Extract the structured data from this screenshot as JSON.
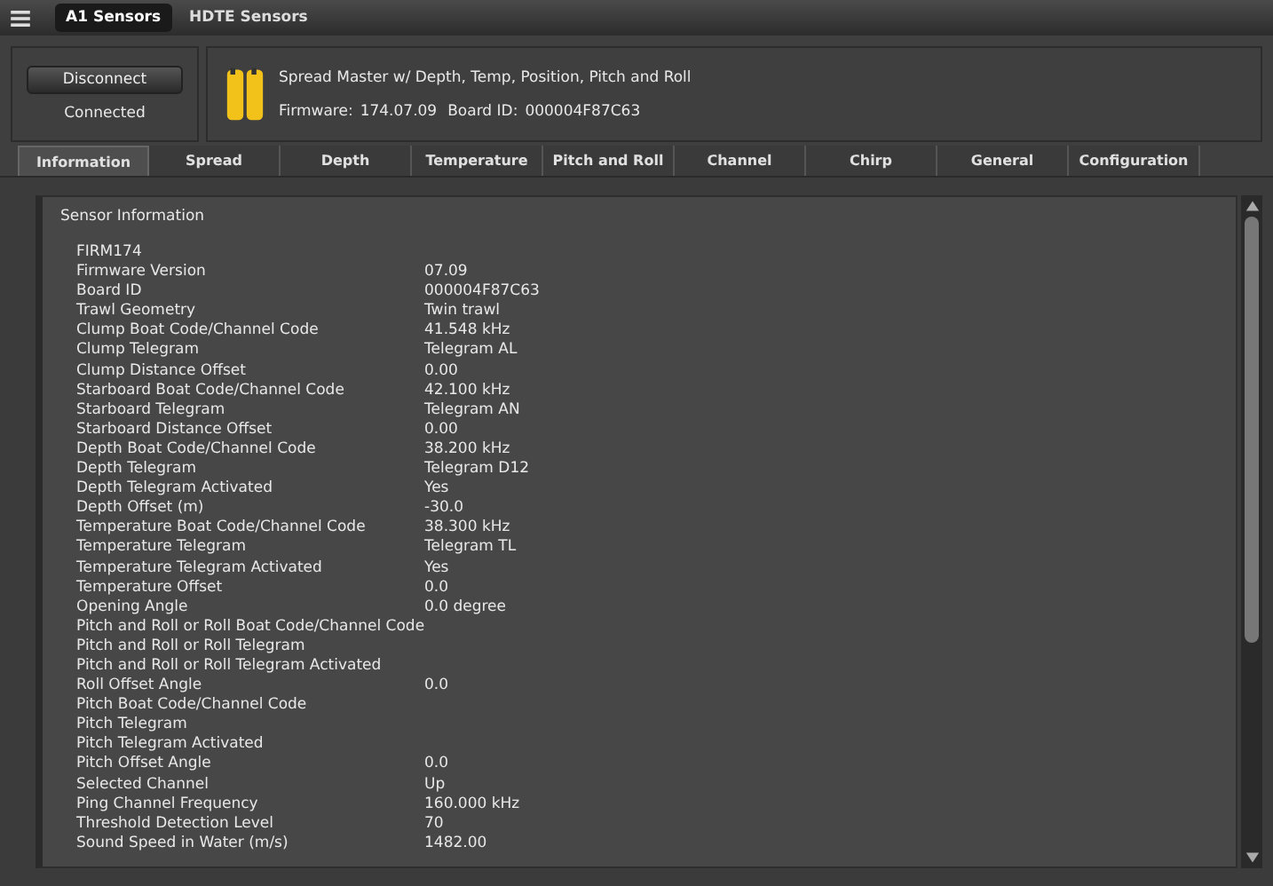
{
  "top_tabs": [
    {
      "label": "A1 Sensors",
      "selected": true
    },
    {
      "label": "HDTE Sensors",
      "selected": false
    }
  ],
  "connection": {
    "button": "Disconnect",
    "status": "Connected"
  },
  "sensor": {
    "name": "Spread Master w/ Depth, Temp, Position, Pitch and Roll",
    "firmware_label": "Firmware:",
    "firmware": "174.07.09",
    "board_label": "Board ID:",
    "board_id": "000004F87C63"
  },
  "tabs": [
    {
      "label": "Information",
      "selected": true
    },
    {
      "label": "Spread",
      "selected": false
    },
    {
      "label": "Depth",
      "selected": false
    },
    {
      "label": "Temperature",
      "selected": false
    },
    {
      "label": "Pitch and Roll",
      "selected": false
    },
    {
      "label": "Channel",
      "selected": false
    },
    {
      "label": "Chirp",
      "selected": false
    },
    {
      "label": "General",
      "selected": false
    },
    {
      "label": "Configuration",
      "selected": false
    }
  ],
  "panel": {
    "title": "Sensor Information",
    "rows": [
      {
        "label": "FIRM174"
      },
      {
        "label": "Firmware Version",
        "value": "07.09"
      },
      {
        "label": "Board ID",
        "value": "000004F87C63"
      },
      {
        "label": "Trawl Geometry",
        "value": "Twin trawl"
      },
      {
        "label": "Clump Boat Code/Channel Code",
        "value": "41.548 kHz"
      },
      {
        "label": "Clump Telegram",
        "value": "Telegram AL"
      },
      {
        "label": "Clump Distance Offset",
        "value": "0.00"
      },
      {
        "label": "Starboard Boat Code/Channel Code",
        "value": "42.100 kHz"
      },
      {
        "label": "Starboard Telegram",
        "value": "Telegram AN"
      },
      {
        "label": "Starboard Distance Offset",
        "value": "0.00"
      },
      {
        "label": "Depth Boat Code/Channel Code",
        "value": "38.200 kHz"
      },
      {
        "label": "Depth Telegram",
        "value": "Telegram D12"
      },
      {
        "label": "Depth Telegram Activated",
        "value": "Yes"
      },
      {
        "label": "Depth Offset (m)",
        "value": "-30.0"
      },
      {
        "label": "Temperature Boat Code/Channel Code",
        "value": "38.300 kHz"
      },
      {
        "label": "Temperature Telegram",
        "value": "Telegram TL"
      },
      {
        "label": "Temperature Telegram Activated",
        "value": "Yes"
      },
      {
        "label": "Temperature Offset",
        "value": "0.0"
      },
      {
        "label": "Opening Angle",
        "value": "0.0 degree"
      },
      {
        "label": "Pitch and Roll or Roll Boat Code/Channel Code"
      },
      {
        "label": "Pitch and Roll or Roll Telegram"
      },
      {
        "label": "Pitch and Roll or Roll Telegram Activated"
      },
      {
        "label": "Roll Offset Angle",
        "value": "0.0"
      },
      {
        "label": "Pitch Boat Code/Channel Code"
      },
      {
        "label": "Pitch Telegram"
      },
      {
        "label": "Pitch Telegram Activated"
      },
      {
        "label": "Pitch Offset Angle",
        "value": "0.0"
      },
      {
        "label": "Selected Channel",
        "value": "Up"
      },
      {
        "label": "Ping Channel Frequency",
        "value": "160.000 kHz"
      },
      {
        "label": "Threshold Detection Level",
        "value": "70"
      },
      {
        "label": "Sound Speed in Water (m/s)",
        "value": "1482.00"
      }
    ]
  }
}
